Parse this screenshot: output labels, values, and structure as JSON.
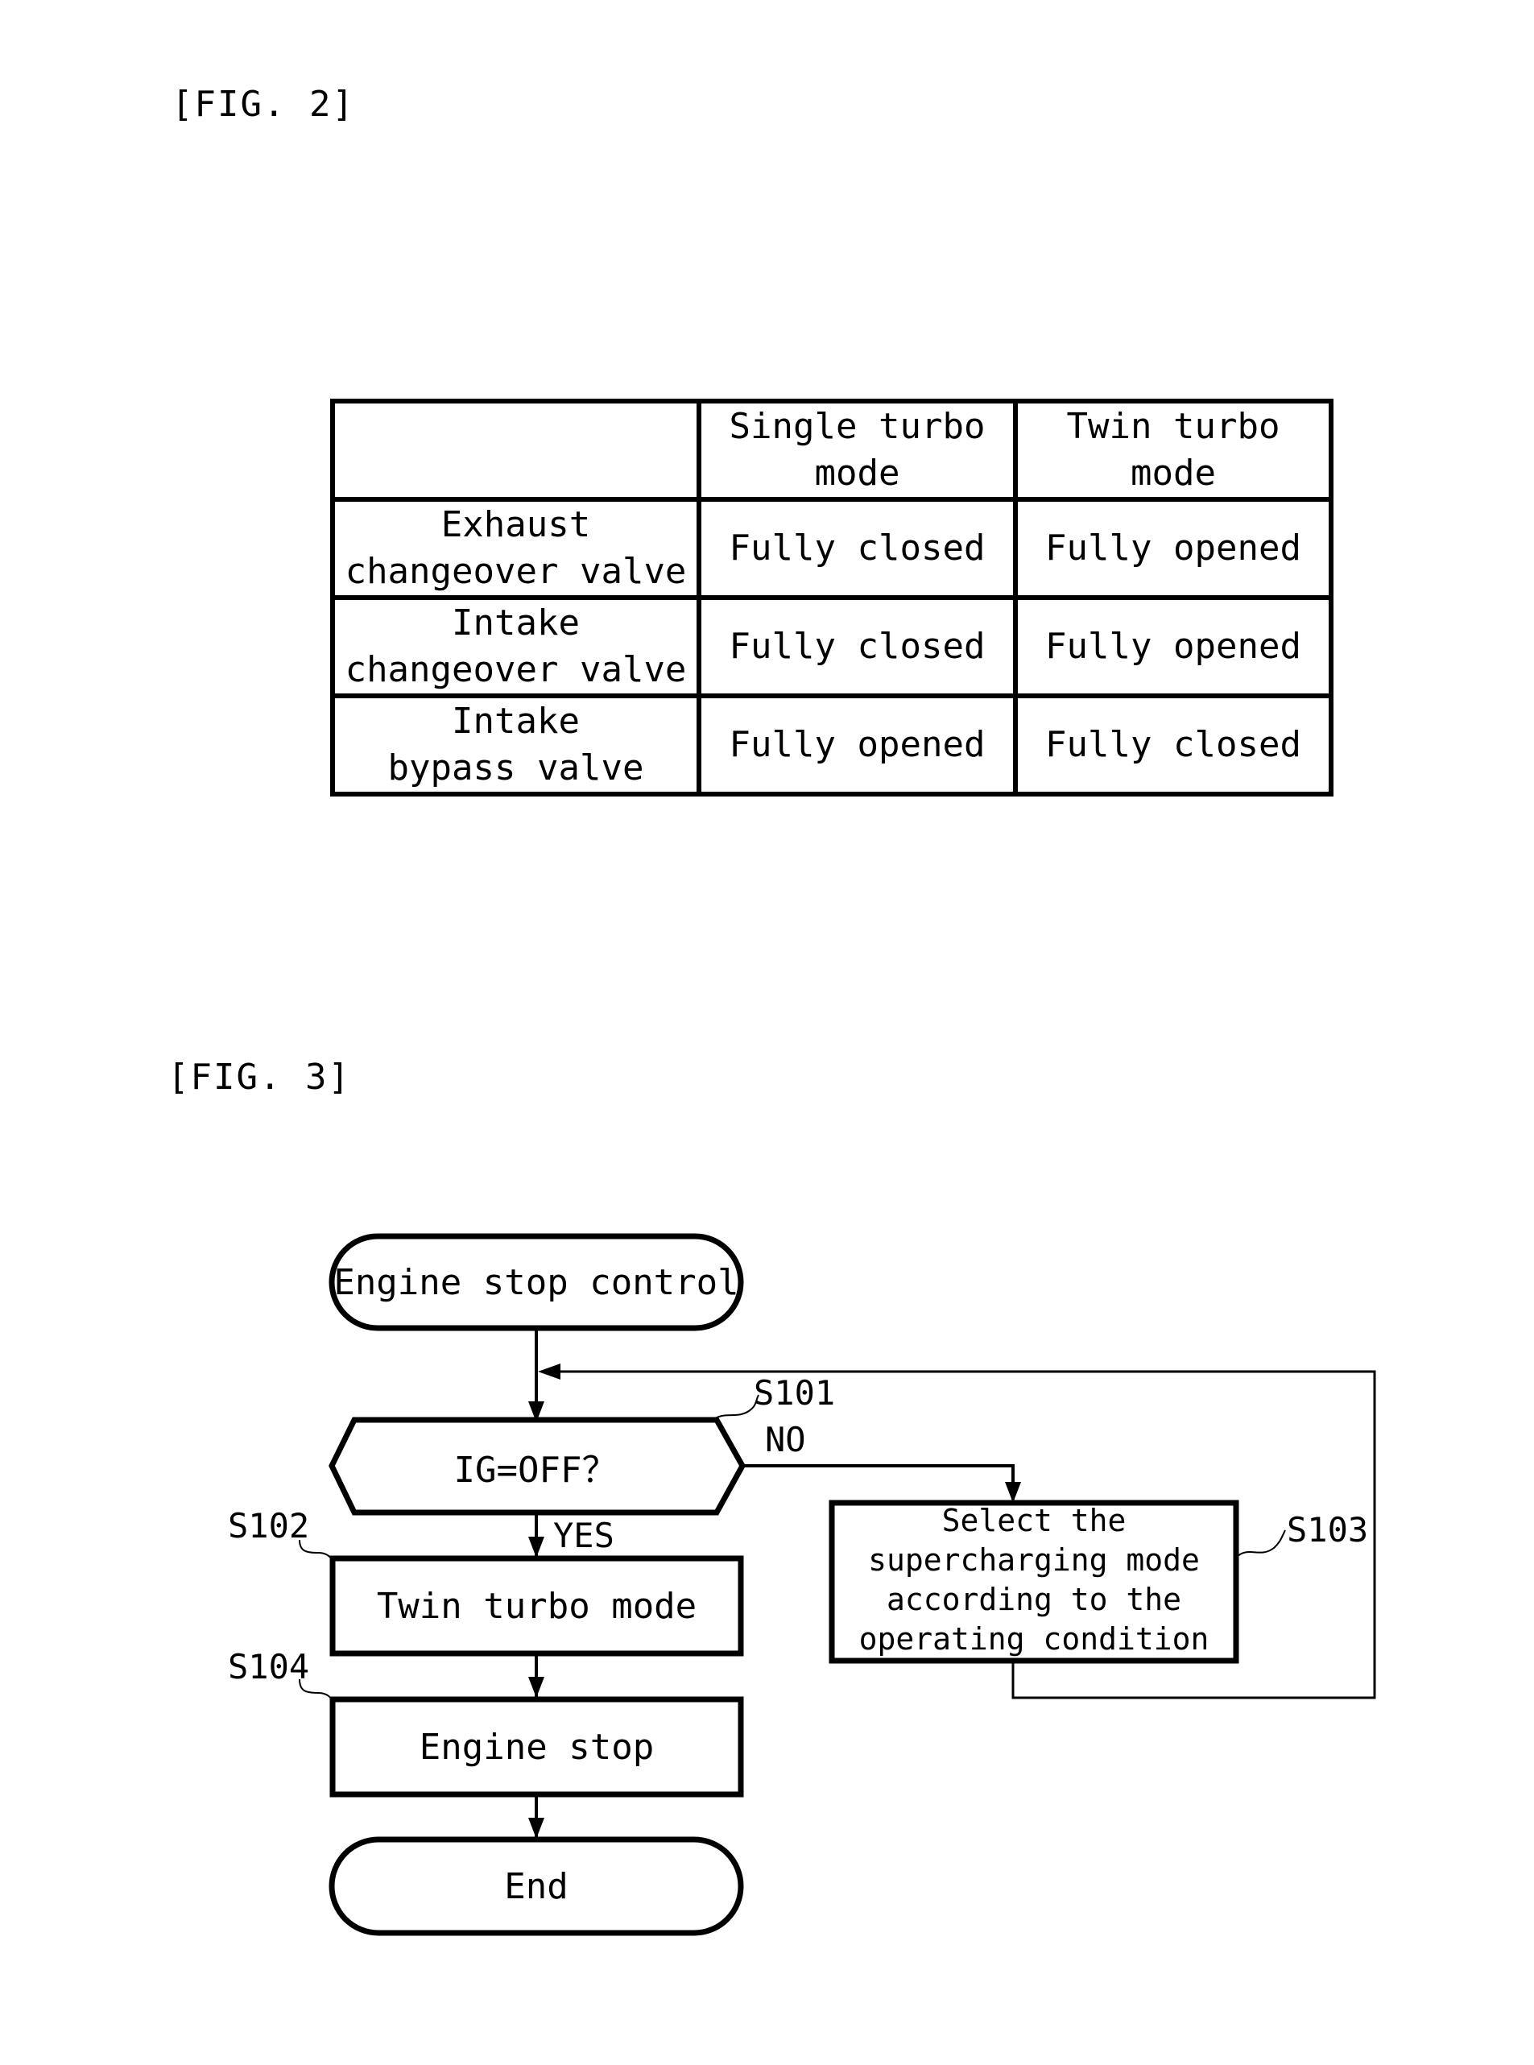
{
  "fig2": {
    "label": "[FIG. 2]",
    "table": {
      "headers": [
        "",
        "Single turbo mode",
        "Twin turbo mode"
      ],
      "header_lines": [
        [
          ""
        ],
        [
          "Single turbo",
          "mode"
        ],
        [
          "Twin turbo",
          "mode"
        ]
      ],
      "rows": [
        {
          "item": "Exhaust changeover valve",
          "item_lines": [
            "Exhaust",
            "changeover valve"
          ],
          "single": "Fully closed",
          "twin": "Fully opened"
        },
        {
          "item": "Intake changeover valve",
          "item_lines": [
            "Intake",
            "changeover valve"
          ],
          "single": "Fully closed",
          "twin": "Fully opened"
        },
        {
          "item": "Intake bypass valve",
          "item_lines": [
            "Intake",
            "bypass valve"
          ],
          "single": "Fully opened",
          "twin": "Fully closed"
        }
      ]
    }
  },
  "fig3": {
    "label": "[FIG. 3]",
    "nodes": {
      "start": {
        "text": "Engine stop control",
        "type": "terminal"
      },
      "s101": {
        "step": "S101",
        "text": "IG=OFF？",
        "type": "decision"
      },
      "s102": {
        "step": "S102",
        "text": "Twin turbo mode",
        "type": "process"
      },
      "s103": {
        "step": "S103",
        "text": "Select the supercharging mode according to the operating condition",
        "lines": [
          "Select the",
          "supercharging mode",
          "according to the",
          "operating condition"
        ],
        "type": "process"
      },
      "s104": {
        "step": "S104",
        "text": "Engine stop",
        "type": "process"
      },
      "end": {
        "text": "End",
        "type": "terminal"
      }
    },
    "branches": {
      "yes": "YES",
      "no": "NO"
    },
    "edges": [
      {
        "from": "start",
        "to": "s101"
      },
      {
        "from": "s101",
        "to": "s102",
        "label": "YES"
      },
      {
        "from": "s101",
        "to": "s103",
        "label": "NO"
      },
      {
        "from": "s103",
        "to": "s101"
      },
      {
        "from": "s102",
        "to": "s104"
      },
      {
        "from": "s104",
        "to": "end"
      }
    ]
  }
}
